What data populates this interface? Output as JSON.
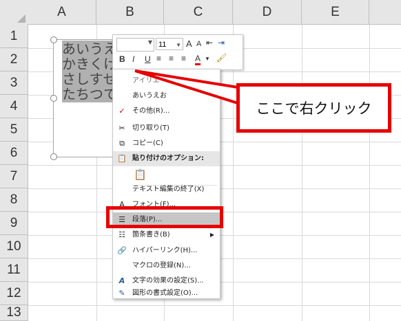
{
  "columns": [
    "A",
    "B",
    "C",
    "D",
    "E"
  ],
  "rows": [
    "1",
    "2",
    "3",
    "4",
    "5",
    "6",
    "7",
    "8",
    "9",
    "10",
    "11",
    "12",
    "13"
  ],
  "shape_text": [
    "あいうえ",
    "かきくけ",
    "さしすせ",
    "たちつてと"
  ],
  "mini_toolbar": {
    "font_name": "",
    "font_size": "11",
    "grow_font": "A",
    "shrink_font": "A",
    "bold": "B",
    "italic": "I",
    "underline": "U",
    "font_color": "A"
  },
  "context_menu": {
    "items": [
      {
        "label": "アイリエ"
      },
      {
        "label": "あいうえお"
      },
      {
        "label": "その他(R)..."
      },
      {
        "label": "切り取り(T)"
      },
      {
        "label": "コピー(C)"
      },
      {
        "label": "貼り付けのオプション:"
      },
      {
        "label": ""
      },
      {
        "label": "テキスト編集の終了(X)"
      },
      {
        "label": "フォント(F)..."
      },
      {
        "label": "段落(P)..."
      },
      {
        "label": "箇条書き(B)"
      },
      {
        "label": "ハイパーリンク(H)..."
      },
      {
        "label": "マクロの登録(N)..."
      },
      {
        "label": "文字の効果の設定(S)..."
      },
      {
        "label": "図形の書式設定(O)..."
      }
    ]
  },
  "callout_text": "ここで右クリック",
  "colors": {
    "annotation": "#e60000",
    "grid_header": "#e6e6e6",
    "highlight": "#c6c6c6"
  }
}
